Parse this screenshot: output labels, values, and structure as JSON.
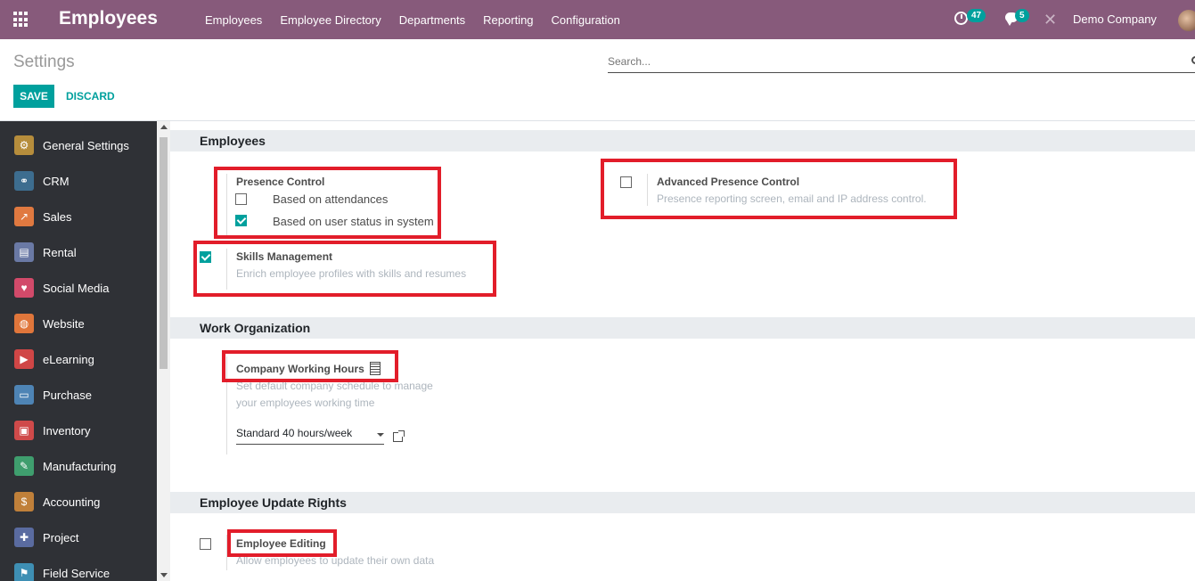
{
  "navbar": {
    "brand": "Employees",
    "menu": [
      "Employees",
      "Employee Directory",
      "Departments",
      "Reporting",
      "Configuration"
    ],
    "activity_count": "47",
    "message_count": "5",
    "company": "Demo Company"
  },
  "control_panel": {
    "title": "Settings",
    "search_placeholder": "Search...",
    "save_label": "SAVE",
    "discard_label": "DISCARD"
  },
  "sidebar": {
    "items": [
      {
        "label": "General Settings",
        "color": "#b68d3c",
        "icon": "gear-icon"
      },
      {
        "label": "CRM",
        "color": "#3d6d8f",
        "icon": "handshake-icon"
      },
      {
        "label": "Sales",
        "color": "#e07940",
        "icon": "chart-icon"
      },
      {
        "label": "Rental",
        "color": "#6a79a5",
        "icon": "rental-icon"
      },
      {
        "label": "Social Media",
        "color": "#d24a6a",
        "icon": "thumbs-up-icon"
      },
      {
        "label": "Website",
        "color": "#e0763b",
        "icon": "globe-icon"
      },
      {
        "label": "eLearning",
        "color": "#d04646",
        "icon": "elearning-icon"
      },
      {
        "label": "Purchase",
        "color": "#4e84b5",
        "icon": "purchase-icon"
      },
      {
        "label": "Inventory",
        "color": "#cf4a4a",
        "icon": "box-icon"
      },
      {
        "label": "Manufacturing",
        "color": "#3f9e6e",
        "icon": "wrench-icon"
      },
      {
        "label": "Accounting",
        "color": "#c0803a",
        "icon": "dollar-icon"
      },
      {
        "label": "Project",
        "color": "#5a6ba0",
        "icon": "puzzle-icon"
      },
      {
        "label": "Field Service",
        "color": "#3e8fb4",
        "icon": "field-service-icon"
      }
    ]
  },
  "sections": {
    "employees": {
      "title": "Employees",
      "presence_control": {
        "title": "Presence Control",
        "opt1": "Based on attendances",
        "opt1_checked": false,
        "opt2": "Based on user status in system",
        "opt2_checked": true
      },
      "advanced_presence": {
        "title": "Advanced Presence Control",
        "desc": "Presence reporting screen, email and IP address control.",
        "checked": false
      },
      "skills": {
        "title": "Skills Management",
        "desc": "Enrich employee profiles with skills and resumes",
        "checked": true
      }
    },
    "work_org": {
      "title": "Work Organization",
      "working_hours": {
        "title": "Company Working Hours",
        "desc1": "Set default company schedule to manage",
        "desc2": "your employees working time",
        "value": "Standard 40 hours/week"
      }
    },
    "update_rights": {
      "title": "Employee Update Rights",
      "editing": {
        "title": "Employee Editing",
        "desc": "Allow employees to update their own data",
        "checked": false
      }
    }
  },
  "colors": {
    "navbar": "#875a7b",
    "accent": "#00a09d",
    "highlight_box": "#e21d2a",
    "sidebar": "#2f3136"
  }
}
